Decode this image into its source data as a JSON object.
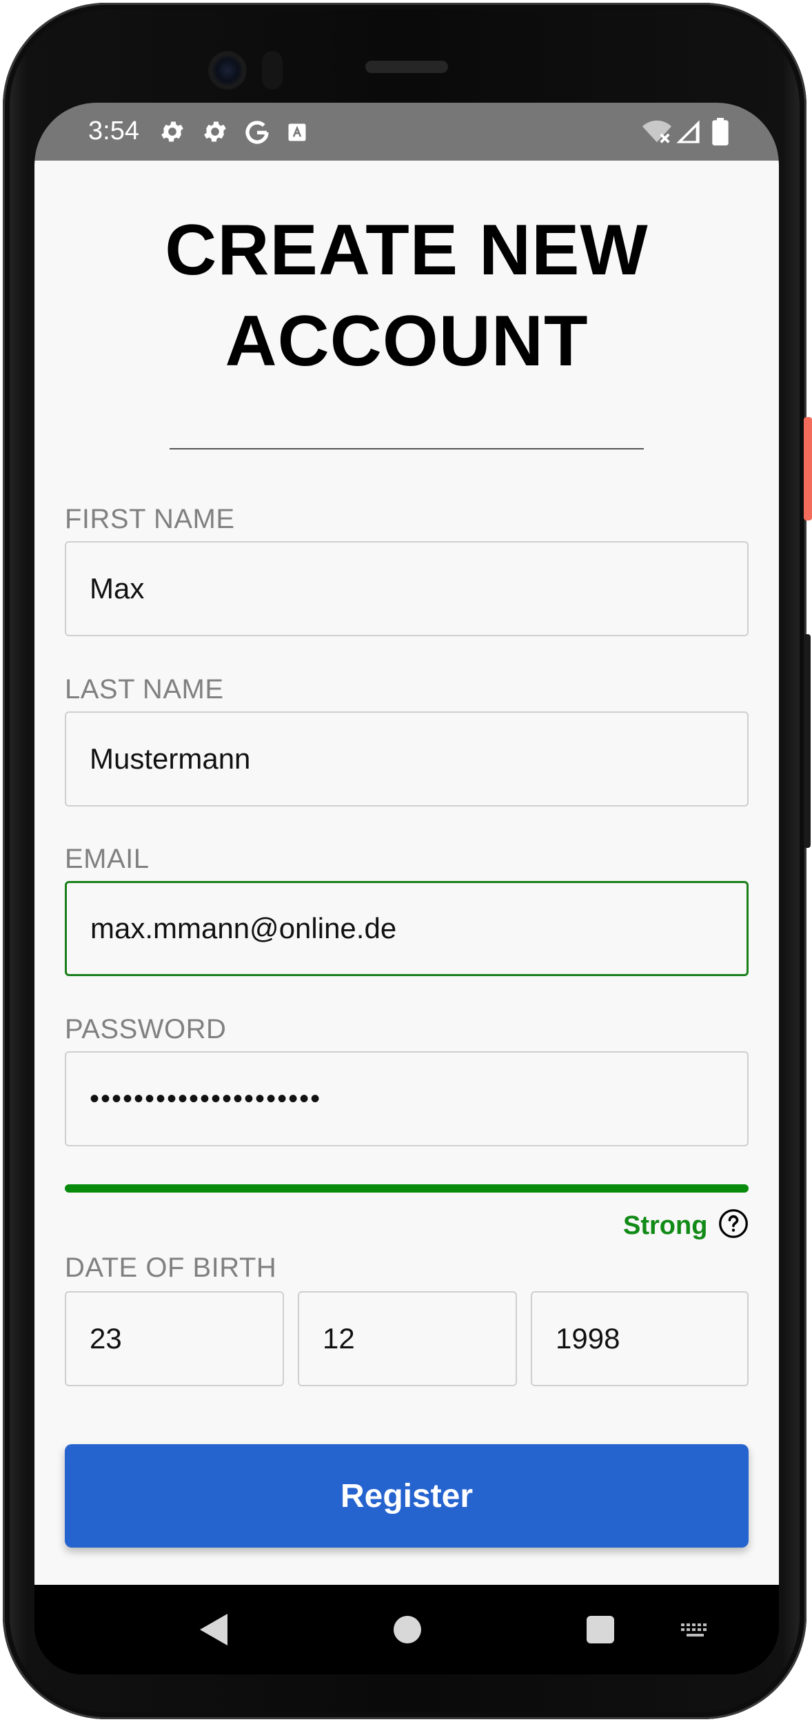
{
  "status_bar": {
    "time": "3:54",
    "left_icons": [
      "settings-icon",
      "settings-icon",
      "google-icon",
      "translate-icon"
    ],
    "right_icons": [
      "wifi-off-icon",
      "signal-icon",
      "battery-icon"
    ]
  },
  "screen": {
    "title_line1": "CREATE NEW",
    "title_line2": "ACCOUNT",
    "fields": {
      "first_name": {
        "label": "FIRST NAME",
        "value": "Max"
      },
      "last_name": {
        "label": "LAST NAME",
        "value": "Mustermann"
      },
      "email": {
        "label": "EMAIL",
        "value": "max.mmann@online.de"
      },
      "password": {
        "label": "PASSWORD",
        "value": "•••••••••••••••••••••"
      }
    },
    "password_strength": {
      "label": "Strong",
      "level": 1.0,
      "color": "#088a0c"
    },
    "date_of_birth": {
      "label": "DATE OF BIRTH",
      "day": "23",
      "month": "12",
      "year": "1998"
    },
    "register_label": "Register"
  },
  "nav_bar": {
    "buttons": [
      "back-icon",
      "home-icon",
      "recents-icon",
      "keyboard-icon"
    ]
  },
  "colors": {
    "accent": "#2563cf",
    "focus_border": "#1a7f1a",
    "strength": "#118a16",
    "status_bar": "#777777"
  }
}
